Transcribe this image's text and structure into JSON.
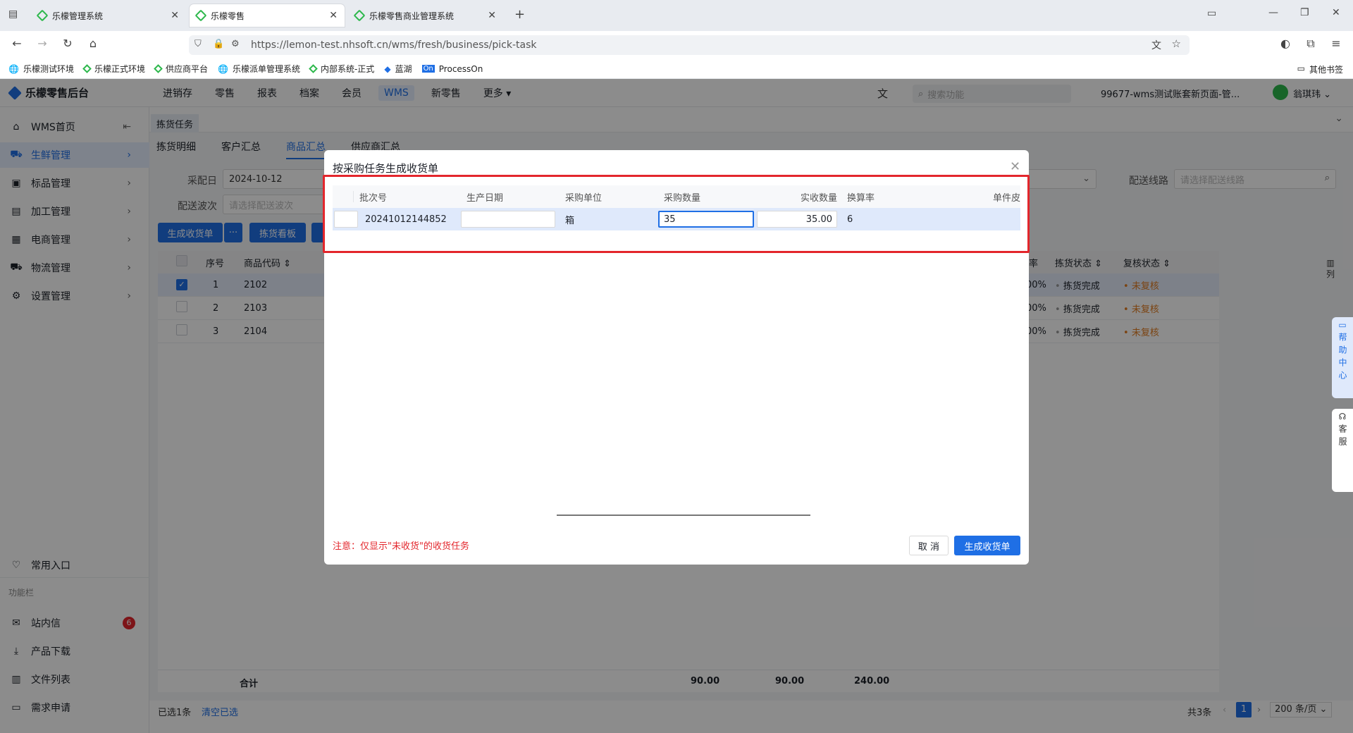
{
  "browser": {
    "tabs": [
      {
        "title": "乐檬管理系统"
      },
      {
        "title": "乐檬零售"
      },
      {
        "title": "乐檬零售商业管理系统"
      }
    ],
    "url": "https://lemon-test.nhsoft.cn/wms/fresh/business/pick-task",
    "bookmarks": [
      "乐檬测试环境",
      "乐檬正式环境",
      "供应商平台",
      "乐檬派单管理系统",
      "内部系统-正式",
      "蓝湖",
      "ProcessOn"
    ],
    "other_bookmarks": "其他书签"
  },
  "app": {
    "logo": "乐檬零售后台",
    "menu": [
      "进销存",
      "零售",
      "报表",
      "档案",
      "会员",
      "WMS",
      "新零售",
      "更多"
    ],
    "active_menu": "WMS",
    "search_placeholder": "搜索功能",
    "account": "99677-wms测试账套新页面-管...",
    "user": "翁琪玮"
  },
  "sidebar": {
    "items": [
      {
        "label": "WMS首页"
      },
      {
        "label": "生鲜管理"
      },
      {
        "label": "标品管理"
      },
      {
        "label": "加工管理"
      },
      {
        "label": "电商管理"
      },
      {
        "label": "物流管理"
      },
      {
        "label": "设置管理"
      }
    ],
    "bottom": {
      "common": "常用入口",
      "section": "功能栏",
      "items": [
        "站内信",
        "产品下载",
        "文件列表",
        "需求申请"
      ],
      "badge": "6"
    }
  },
  "page": {
    "tab": "拣货任务",
    "subtabs": [
      "拣货明细",
      "客户汇总",
      "商品汇总",
      "供应商汇总"
    ],
    "filters": {
      "date_label": "采配日",
      "date_value": "2024-10-12",
      "wave_label": "配送波次",
      "wave_placeholder": "请选择配送波次",
      "route_label": "配送线路",
      "route_placeholder": "请选择配送线路"
    },
    "buttons": {
      "generate": "生成收货单",
      "more": "···",
      "board": "拣货看板"
    },
    "table": {
      "headers": {
        "index": "序号",
        "code": "商品代码",
        "rate_tail": "率",
        "pick_status": "拣货状态",
        "review_status": "复核状态",
        "column": "列"
      },
      "rows": [
        {
          "index": "1",
          "code": "2102",
          "rate": "00%",
          "pick": "拣货完成",
          "review": "未复核",
          "checked": true
        },
        {
          "index": "2",
          "code": "2103",
          "rate": "00%",
          "pick": "拣货完成",
          "review": "未复核",
          "checked": false
        },
        {
          "index": "3",
          "code": "2104",
          "rate": "00%",
          "pick": "拣货完成",
          "review": "未复核",
          "checked": false
        }
      ],
      "footer": {
        "label": "合计",
        "v1": "90.00",
        "v2": "90.00",
        "v3": "240.00"
      }
    },
    "bottom": {
      "selected": "已选1条",
      "clear": "清空已选",
      "total": "共3条",
      "page": "1",
      "page_size": "200 条/页"
    },
    "side_help": {
      "help": "帮助中心",
      "service": "客服"
    }
  },
  "modal": {
    "title": "按采购任务生成收货单",
    "headers": [
      "批次号",
      "生产日期",
      "采购单位",
      "采购数量",
      "实收数量",
      "换算率",
      "单件皮"
    ],
    "row": {
      "batch": "20241012144852",
      "date": "",
      "unit": "箱",
      "qty": "35",
      "received": "35.00",
      "rate": "6"
    },
    "note": "注意：仅显示\"未收货\"的收货任务",
    "cancel": "取 消",
    "confirm": "生成收货单"
  }
}
